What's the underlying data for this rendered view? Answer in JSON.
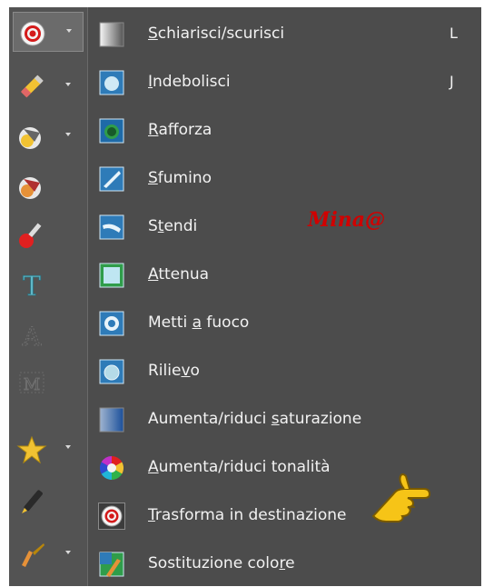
{
  "toolbar": {
    "tools": [
      {
        "icon": "target-icon",
        "dropdown": true,
        "active": true
      },
      {
        "icon": "pencil-icon",
        "dropdown": true
      },
      {
        "icon": "eraser-icon",
        "dropdown": true
      },
      {
        "icon": "background-eraser-icon",
        "dropdown": false
      },
      {
        "icon": "color-picker-icon",
        "dropdown": false
      },
      {
        "icon": "text-icon",
        "dropdown": false
      },
      {
        "icon": "text-outline-icon",
        "dropdown": false
      },
      {
        "icon": "text-mask-icon",
        "dropdown": false
      },
      {
        "icon": "star-shape-icon",
        "dropdown": true
      },
      {
        "icon": "pen-icon",
        "dropdown": false
      },
      {
        "icon": "brush-icon",
        "dropdown": true
      }
    ]
  },
  "menu": {
    "items": [
      {
        "pre": "",
        "u": "S",
        "post": "chiarisci/scurisci",
        "key": "L",
        "icon": "dodge-burn-icon"
      },
      {
        "pre": "",
        "u": "I",
        "post": "ndebolisci",
        "key": "J",
        "icon": "soften-icon"
      },
      {
        "pre": "",
        "u": "R",
        "post": "afforza",
        "key": "",
        "icon": "sharpen-icon"
      },
      {
        "pre": "",
        "u": "S",
        "post": "fumino",
        "key": "",
        "icon": "smudge-icon"
      },
      {
        "pre": "S",
        "u": "t",
        "post": "endi",
        "key": "",
        "icon": "push-icon"
      },
      {
        "pre": "",
        "u": "A",
        "post": "ttenua",
        "key": "",
        "icon": "lighten-icon"
      },
      {
        "pre": "Metti ",
        "u": "a",
        "post": " fuoco",
        "key": "",
        "icon": "focus-icon"
      },
      {
        "pre": "Rilie",
        "u": "v",
        "post": "o",
        "key": "",
        "icon": "emboss-icon"
      },
      {
        "pre": "Aumenta/riduci ",
        "u": "s",
        "post": "aturazione",
        "key": "",
        "icon": "saturation-icon"
      },
      {
        "pre": "",
        "u": "A",
        "post": "umenta/riduci tonalità",
        "key": "",
        "icon": "hue-wheel-icon"
      },
      {
        "pre": "",
        "u": "T",
        "post": "rasforma in destinazione",
        "key": "",
        "icon": "target-icon"
      },
      {
        "pre": "Sostituzione colo",
        "u": "r",
        "post": "e",
        "key": "",
        "icon": "color-replace-icon"
      }
    ]
  },
  "signature": "Mina@"
}
